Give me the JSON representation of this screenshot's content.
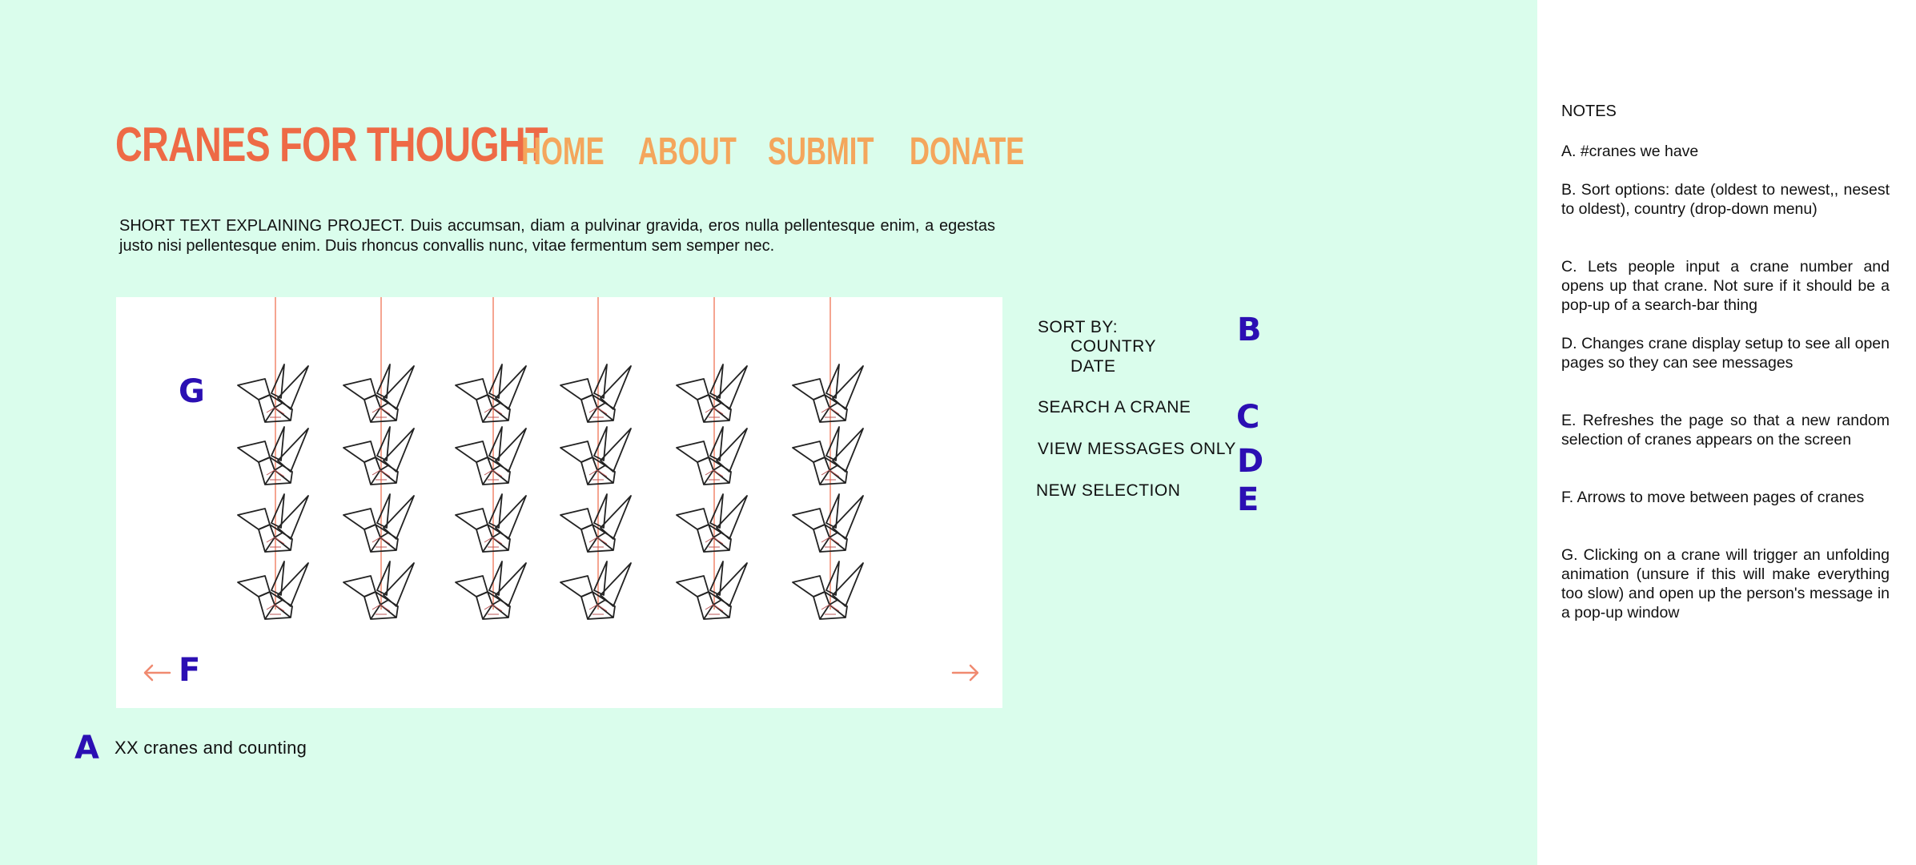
{
  "header": {
    "logo": "CRANES FOR THOUGHT",
    "nav": [
      "HOME",
      "ABOUT",
      "SUBMIT",
      "DONATE"
    ]
  },
  "intro": "SHORT TEXT EXPLAINING PROJECT. Duis accumsan, diam a pulvinar gravida, eros nulla pellentesque enim, a egestas justo nisi pellentesque enim. Duis rhoncus convallis nunc, vitae fermentum sem semper nec.",
  "gallery": {
    "columns": 6,
    "rows": 4,
    "crane_icon": "paper-crane-icon",
    "prev_icon": "arrow-left-icon",
    "next_icon": "arrow-right-icon"
  },
  "sidebar": {
    "sort_label": "SORT BY:",
    "sort_options": [
      "COUNTRY",
      "DATE"
    ],
    "search": "SEARCH A CRANE",
    "view_messages": "VIEW MESSAGES ONLY",
    "new_selection": "NEW SELECTION"
  },
  "annotations": {
    "a": "A",
    "b": "B",
    "c": "C",
    "d": "D",
    "e": "E",
    "f": "F",
    "g": "G"
  },
  "counter": "XX cranes and counting",
  "notes": {
    "heading": "NOTES",
    "items": [
      "A. #cranes we have",
      "B. Sort options: date (oldest to newest,, nesest to oldest), country (drop-down menu)",
      "C. Lets people input a crane number and opens up that crane. Not sure if it should be a pop-up of a search-bar thing",
      "D. Changes crane display setup to see all open pages so they can see messages",
      "E. Refreshes the page so that a new random selection of cranes appears on the screen",
      "F. Arrows to move between pages of cranes",
      "G. Clicking on a crane will trigger an unfolding animation (unsure if this will make everything too slow) and open up the person's message in a pop-up window"
    ]
  },
  "colors": {
    "background": "#dafdec",
    "logo": "#ee6a46",
    "nav": "#f4a65c",
    "annotation": "#2b0fb3",
    "string": "#f5a591",
    "arrow": "#f08a70"
  }
}
